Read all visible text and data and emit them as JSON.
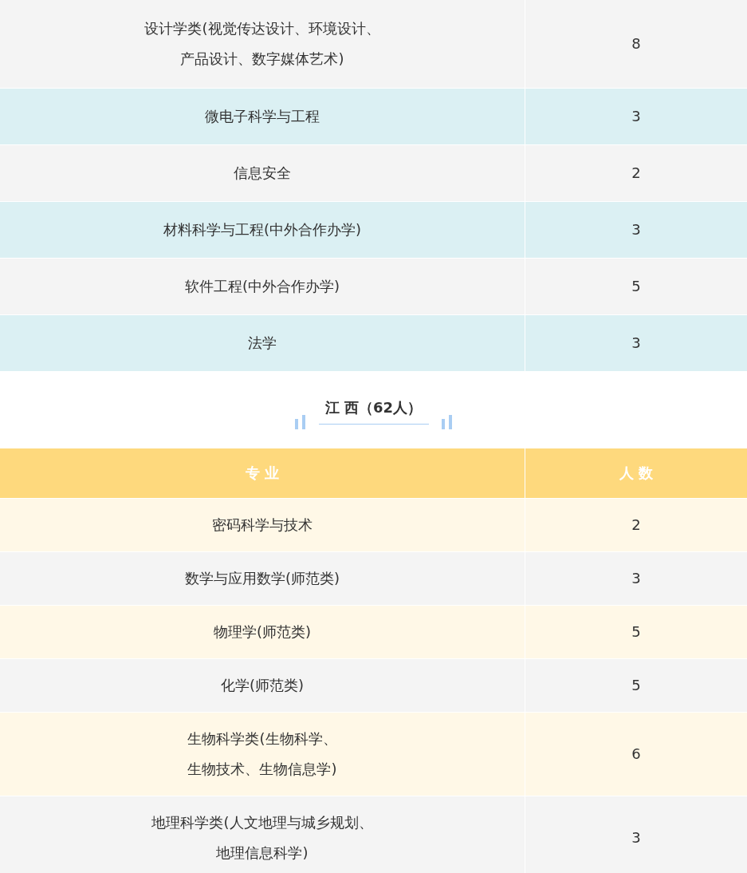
{
  "tables": [
    {
      "rows": [
        {
          "major": [
            "设计学类(视觉传达设计、环境设计、",
            "产品设计、数字媒体艺术)"
          ],
          "count": "8"
        },
        {
          "major": "微电子科学与工程",
          "count": "3"
        },
        {
          "major": "信息安全",
          "count": "2"
        },
        {
          "major": "材料科学与工程(中外合作办学)",
          "count": "3"
        },
        {
          "major": "软件工程(中外合作办学)",
          "count": "5"
        },
        {
          "major": "法学",
          "count": "3"
        }
      ]
    },
    {
      "title": "江 西（62人）",
      "columns": [
        "专 业",
        "人 数"
      ],
      "rows": [
        {
          "major": "密码科学与技术",
          "count": "2"
        },
        {
          "major": "数学与应用数学(师范类)",
          "count": "3"
        },
        {
          "major": "物理学(师范类)",
          "count": "5"
        },
        {
          "major": "化学(师范类)",
          "count": "5"
        },
        {
          "major": [
            "生物科学类(生物科学、",
            "生物技术、生物信息学)"
          ],
          "count": "6"
        },
        {
          "major": [
            "地理科学类(人文地理与城乡规划、",
            "地理信息科学)"
          ],
          "count": "3"
        }
      ]
    }
  ]
}
